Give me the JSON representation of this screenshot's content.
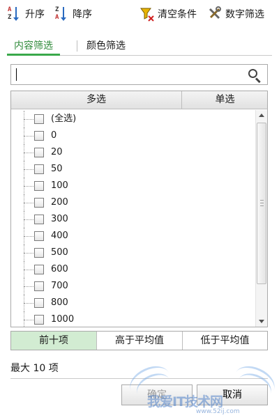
{
  "toolbar": {
    "sort_asc": "升序",
    "sort_desc": "降序",
    "clear": "清空条件",
    "number_filter": "数字筛选",
    "sort_asc_icon": {
      "top": "A",
      "bottom": "Z"
    },
    "sort_desc_icon": {
      "top": "Z",
      "bottom": "A"
    }
  },
  "tabs": [
    {
      "label": "内容筛选",
      "active": true
    },
    {
      "label": "颜色筛选",
      "active": false
    }
  ],
  "search": {
    "value": "",
    "placeholder": ""
  },
  "list": {
    "header_multi": "多选",
    "header_single": "单选",
    "items": [
      "(全选)",
      "0",
      "20",
      "50",
      "100",
      "200",
      "300",
      "400",
      "500",
      "600",
      "700",
      "800",
      "1000"
    ]
  },
  "bottom_tabs": [
    {
      "label": "前十项",
      "active": true
    },
    {
      "label": "高于平均值",
      "active": false
    },
    {
      "label": "低于平均值",
      "active": false
    }
  ],
  "max_info": "最大 10 项",
  "buttons": {
    "ok": "确定",
    "cancel": "取消"
  },
  "watermark": {
    "text": "我爱IT技术网",
    "sub": "www.52ij.com"
  },
  "colors": {
    "accent_green": "#3aa84a",
    "active_tab_bg": "#d2ecd2",
    "border": "#a9a9a9"
  }
}
